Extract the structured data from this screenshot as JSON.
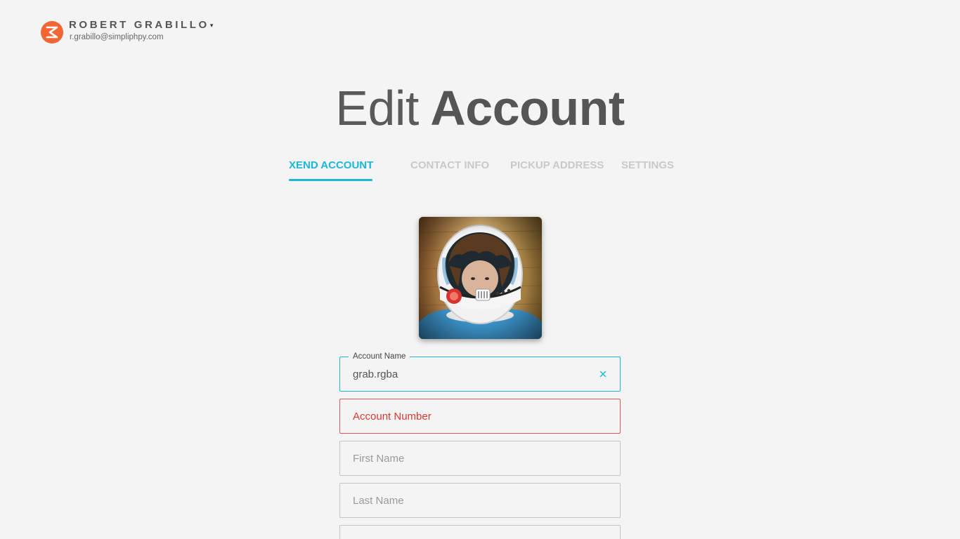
{
  "user": {
    "name": "ROBERT GRABILLO",
    "caret": "▾",
    "email": "r.grabillo@simpliphpy.com",
    "logo_color": "#f26634"
  },
  "title": {
    "light": "Edit",
    "bold": "Account"
  },
  "tabs": [
    {
      "label": "XEND ACCOUNT",
      "active": true
    },
    {
      "label": "CONTACT INFO",
      "active": false
    },
    {
      "label": "PICKUP ADDRESS",
      "active": false
    },
    {
      "label": "SETTINGS",
      "active": false
    }
  ],
  "avatar": {
    "icon": "astronaut-helmet-photo"
  },
  "form": {
    "account_name": {
      "label": "Account Name",
      "value": "grab.rgba"
    },
    "account_number": {
      "placeholder": "Account Number"
    },
    "first_name": {
      "placeholder": "First Name"
    },
    "last_name": {
      "placeholder": "Last Name"
    },
    "next_field": {
      "placeholder": ""
    }
  },
  "colors": {
    "accent": "#1ab7d6",
    "error": "#d9392f",
    "brand": "#f26634",
    "background": "#f4f4f4"
  }
}
